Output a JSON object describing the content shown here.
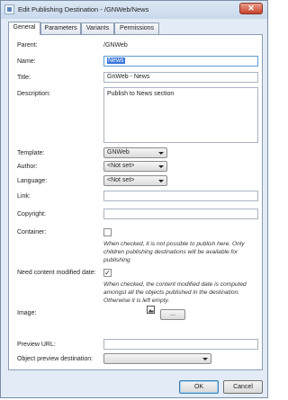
{
  "window": {
    "title": "Edit Publishing Destination - /GNWeb/News",
    "close_glyph": "✕"
  },
  "tabs": [
    {
      "label": "General",
      "active": true
    },
    {
      "label": "Parameters",
      "active": false
    },
    {
      "label": "Variants",
      "active": false
    },
    {
      "label": "Permissions",
      "active": false
    }
  ],
  "form": {
    "parent_label": "Parent:",
    "parent_value": "/GNWeb",
    "name_label": "Name:",
    "name_value": "News",
    "title_label": "Title:",
    "title_value": "GnWeb - News",
    "description_label": "Description:",
    "description_value": "Publish to News section",
    "template_label": "Template:",
    "template_value": "GNWeb",
    "author_label": "Author:",
    "author_value": "<Not set>",
    "language_label": "Language:",
    "language_value": "<Not set>",
    "link_label": "Link:",
    "link_value": "",
    "copyright_label": "Copyright:",
    "copyright_value": "",
    "container_label": "Container:",
    "container_checked": false,
    "container_note": "When checked, it is not possible to publish here. Only children publishing destinations will be available for publishing",
    "need_modified_label": "Need content modified date:",
    "need_modified_checked": true,
    "need_modified_check_glyph": "✓",
    "need_modified_note": "When checked, the content modified date is computed amongst all the objects published in the destination. Otherwise it is left empty.",
    "image_label": "Image:",
    "image_browse_label": "...",
    "preview_url_label": "Preview URL:",
    "preview_url_value": "",
    "object_preview_label": "Object preview destination:",
    "object_preview_value": ""
  },
  "footer": {
    "ok_label": "OK",
    "cancel_label": "Cancel"
  }
}
